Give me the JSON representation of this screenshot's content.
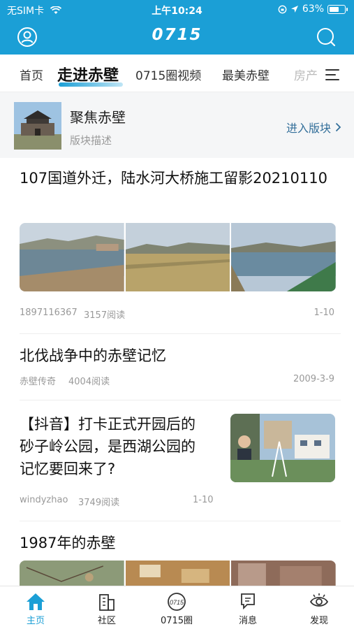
{
  "status_bar": {
    "carrier": "无SIM卡",
    "time": "上午10:24",
    "battery": "63%",
    "battery_level": 0.63
  },
  "header": {
    "brand": "0715"
  },
  "tabs": [
    {
      "label": "首页"
    },
    {
      "label": "走进赤壁"
    },
    {
      "label": "0715圈视频"
    },
    {
      "label": "最美赤壁"
    },
    {
      "label": "房产"
    }
  ],
  "forum": {
    "title": "聚焦赤壁",
    "description": "版块描述",
    "enter_label": "进入版块"
  },
  "articles": [
    {
      "title": "107国道外迁，陆水河大桥施工留影20210110",
      "author": "1897116367",
      "reads": "3157阅读",
      "date": "1-10"
    },
    {
      "title": "北伐战争中的赤壁记忆",
      "author": "赤壁传奇",
      "reads": "4004阅读",
      "date": "2009-3-9"
    },
    {
      "title": "【抖音】打卡正式开园后的砂子岭公园，是西湖公园的记忆要回来了?",
      "author": "windyzhao",
      "reads": "3749阅读",
      "date": "1-10"
    },
    {
      "title": "1987年的赤壁"
    }
  ],
  "bottom_nav": [
    {
      "label": "主页"
    },
    {
      "label": "社区"
    },
    {
      "label": "0715圈"
    },
    {
      "label": "消息"
    },
    {
      "label": "发现"
    }
  ],
  "colors": {
    "brand_blue": "#1b9fd6",
    "text": "#222222",
    "meta": "#999999"
  }
}
